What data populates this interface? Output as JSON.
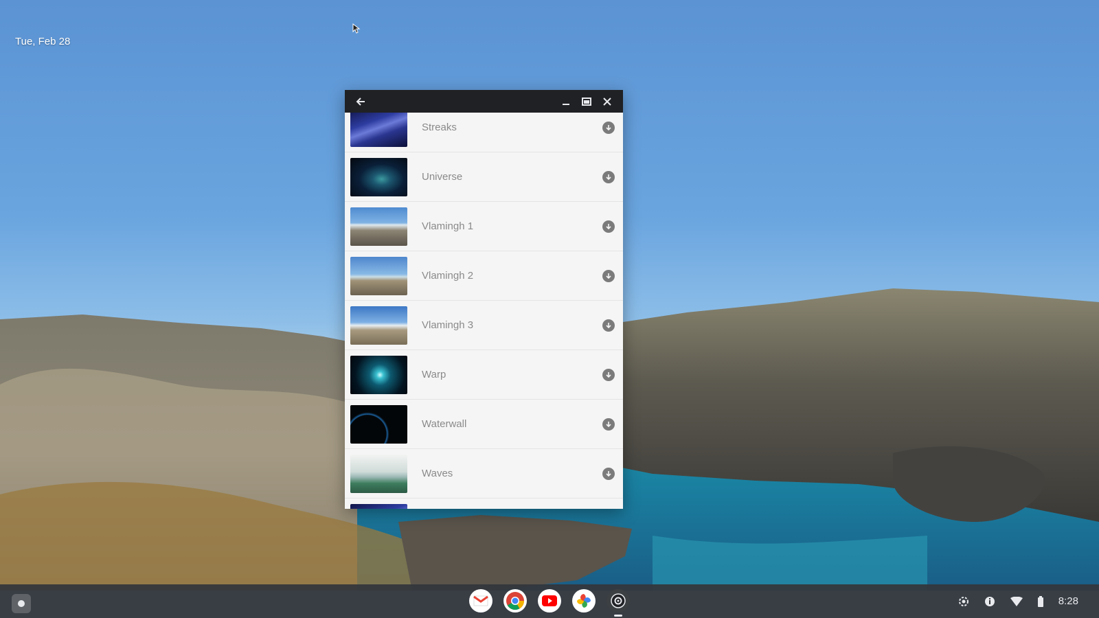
{
  "desktop": {
    "date": "Tue, Feb 28"
  },
  "window": {
    "items": [
      {
        "label": "Streaks",
        "thumb": "streaks"
      },
      {
        "label": "Universe",
        "thumb": "universe"
      },
      {
        "label": "Vlamingh 1",
        "thumb": "vlam1"
      },
      {
        "label": "Vlamingh 2",
        "thumb": "vlam2"
      },
      {
        "label": "Vlamingh 3",
        "thumb": "vlam3"
      },
      {
        "label": "Warp",
        "thumb": "warp"
      },
      {
        "label": "Waterwall",
        "thumb": "waterwall"
      },
      {
        "label": "Waves",
        "thumb": "waves"
      }
    ]
  },
  "shelf": {
    "apps": [
      "gmail-icon",
      "chrome-icon",
      "youtube-icon",
      "photos-icon",
      "camera-icon"
    ],
    "time": "8:28"
  },
  "colors": {
    "titlebar": "#202124",
    "shelf": "#34373c",
    "sky": "#6aa5df"
  }
}
